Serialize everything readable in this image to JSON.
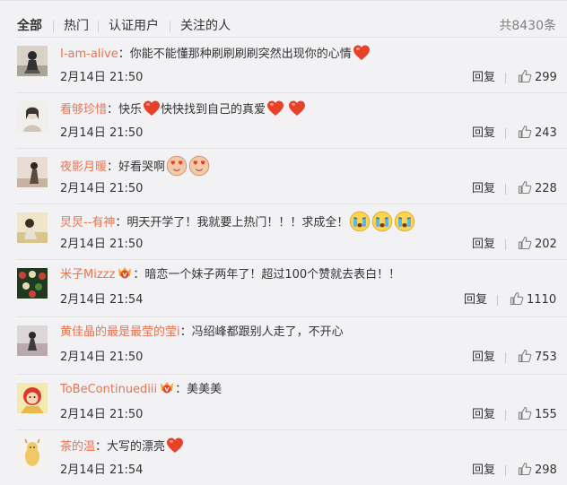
{
  "tabs": [
    "全部",
    "热门",
    "认证用户",
    "关注的人"
  ],
  "total": "共8430条",
  "reply_label": "回复",
  "comments": [
    {
      "user": "I-am-alive",
      "verified": false,
      "text": "：你能不能懂那种刷刷刷刷突然出现你的心情",
      "emoji": [
        "heart"
      ],
      "time": "2月14日 21:50",
      "likes": "299"
    },
    {
      "user": "看够珍惜",
      "verified": false,
      "text": "：快乐",
      "text2": "快快找到自己的真爱",
      "emoji": [
        "heart",
        "heart",
        "heart"
      ],
      "time": "2月14日 21:50",
      "likes": "243"
    },
    {
      "user": "夜影月暖",
      "verified": false,
      "text": "：好看哭啊",
      "emoji": [
        "love-eyes",
        "love-eyes"
      ],
      "time": "2月14日 21:50",
      "likes": "228"
    },
    {
      "user": "炅炅--有神",
      "verified": false,
      "text": "：明天开学了！我就要上热门！！！求成全！",
      "emoji": [
        "crying",
        "crying",
        "crying"
      ],
      "time": "2月14日 21:50",
      "likes": "202"
    },
    {
      "user": "米子Mizzz",
      "verified": true,
      "text": "：暗恋一个妹子两年了！超过100个赞就去表白！！",
      "emoji": [],
      "time": "2月14日 21:54",
      "likes": "1110"
    },
    {
      "user": "黄佳晶的最是最莹的莹i",
      "verified": false,
      "text": "：冯绍峰都跟别人走了，不开心",
      "emoji": [],
      "time": "2月14日 21:50",
      "likes": "753"
    },
    {
      "user": "ToBeContinuediii",
      "verified": true,
      "text": "：美美美",
      "emoji": [],
      "time": "2月14日 21:50",
      "likes": "155"
    },
    {
      "user": "茶的温",
      "verified": false,
      "text": "：大写的漂亮",
      "emoji": [
        "heart"
      ],
      "time": "2月14日 21:54",
      "likes": "298"
    }
  ],
  "colors": {
    "username": "#eb7350",
    "background": "#f2f2f5",
    "heart": "#e8412a"
  }
}
